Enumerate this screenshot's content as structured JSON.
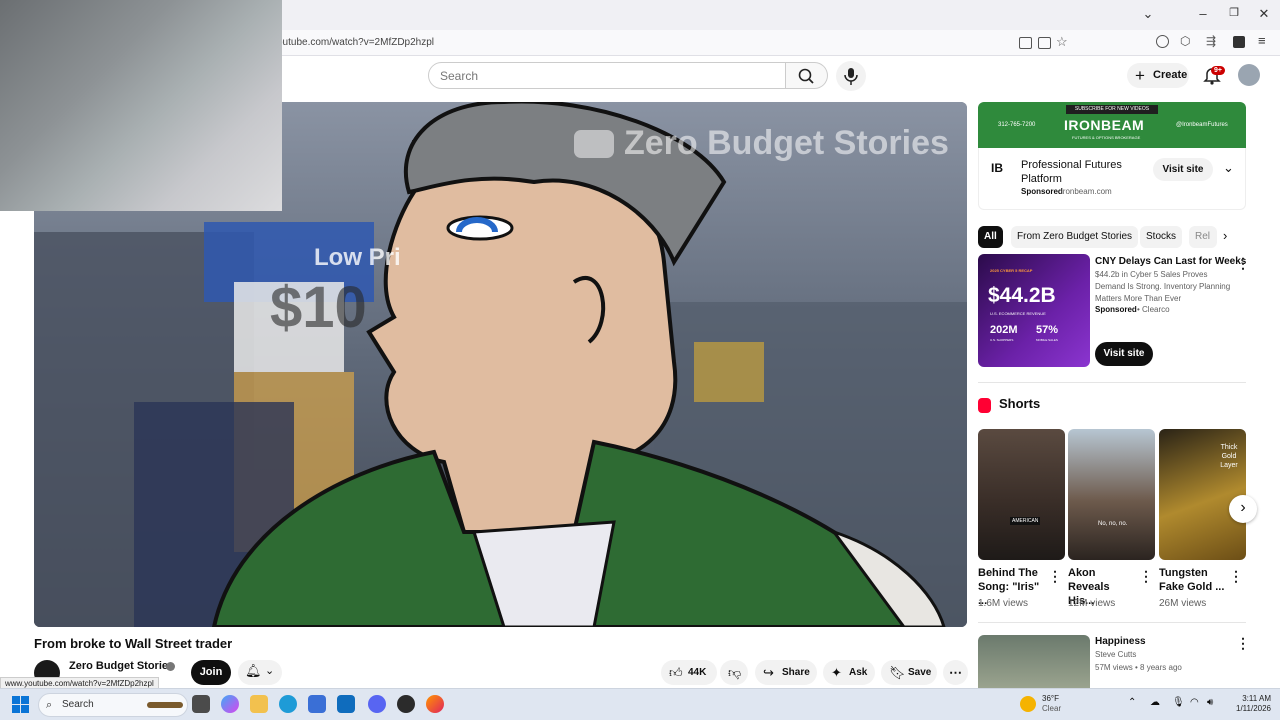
{
  "browser": {
    "url": "youtube.com/watch?v=2MfZDp2hzpl",
    "status_url": "www.youtube.com/watch?v=2MfZDp2hzpl"
  },
  "header": {
    "search_placeholder": "Search",
    "create_label": "Create",
    "notifications_badge": "9+"
  },
  "video": {
    "watermark": "Zero Budget Stories",
    "title": "From broke to Wall Street trader",
    "channel": "Zero Budget Stories",
    "join_label": "Join",
    "likes": "44K",
    "share_label": "Share",
    "ask_label": "Ask",
    "save_label": "Save",
    "store_sign": "Low Pri",
    "store_price": "$10"
  },
  "sidebar": {
    "ad_banner": {
      "top_strip": "SUBSCRIBE FOR NEW VIDEOS",
      "phone": "312-765-7200",
      "brand": "IRONBEAM",
      "tagline": "FUTURES & OPTIONS BROKERAGE",
      "handle": "@IronbeamFutures"
    },
    "ad_card": {
      "logo": "IB",
      "title": "Professional Futures Platform",
      "sponsored": "Sponsored",
      "domain": "ironbeam.com",
      "visit_label": "Visit site"
    },
    "chips": [
      "All",
      "From Zero Budget Stories",
      "Stocks",
      "Rel"
    ],
    "clearco": {
      "thumb_tag": "2025 CYBER 5 RECAP",
      "thumb_value": "$44.2B",
      "thumb_caption": "U.S. ECOMMERCE REVENUE",
      "stat1": "202M",
      "stat1_caption": "U.S. SHOPPERS",
      "stat2": "57%",
      "stat2_caption": "MOBILE SALES",
      "title": "CNY Delays Can Last for Weeks",
      "desc": "$44.2b in Cyber 5 Sales Proves Demand Is Strong. Inventory Planning Matters More Than Ever",
      "sponsored": "Sponsored",
      "advertiser": "Clearco",
      "visit_label": "Visit site"
    },
    "shorts_heading": "Shorts",
    "shorts": [
      {
        "title": "Behind The Song: \"Iris\" ...",
        "views": "1.6M views",
        "overlay": "AMERICAN"
      },
      {
        "title": "Akon Reveals His...",
        "views": "12M views",
        "overlay": "No, no, no."
      },
      {
        "title": "Tungsten Fake Gold ...",
        "views": "26M views",
        "overlay": "Thick Gold Layer"
      }
    ],
    "next_video": {
      "title": "Happiness",
      "channel": "Steve Cutts",
      "meta": "57M views • 8 years ago"
    }
  },
  "taskbar": {
    "search_label": "Search",
    "temperature": "36°F",
    "weather": "Clear",
    "time": "3:11 AM",
    "date": "1/11/2026"
  }
}
